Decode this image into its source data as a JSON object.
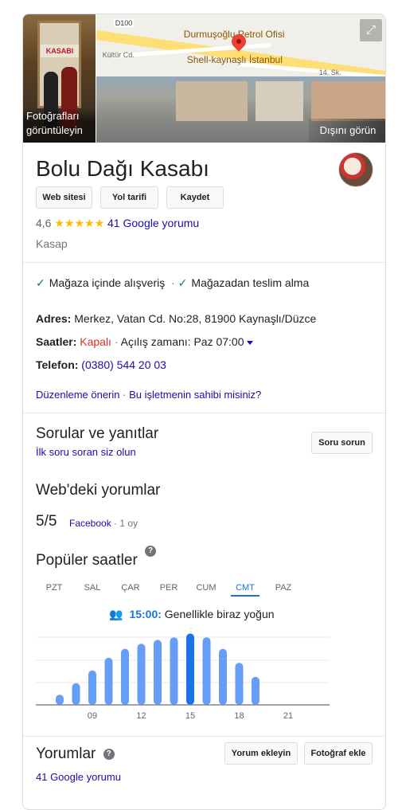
{
  "hero": {
    "photo_caption": "Fotoğrafları görüntüleyin",
    "shop_sign": "KASABI",
    "outside_caption": "Dışını görün",
    "map_labels": {
      "road": "D100",
      "poi1": "Durmuşoğlu Petrol Ofisi",
      "poi2": "Shell-kaynaşlı İstanbul",
      "street1": "Kültür Cd.",
      "street2": "14. Sk."
    }
  },
  "business": {
    "name": "Bolu Dağı Kasabı",
    "buttons": [
      "Web sitesi",
      "Yol tarifi",
      "Kaydet"
    ],
    "rating": "4,6",
    "stars_value": 4.6,
    "reviews_link": "41 Google yorumu",
    "category": "Kasap"
  },
  "features": [
    "Mağaza içinde alışveriş",
    "Mağazadan teslim alma"
  ],
  "info": {
    "address_label": "Adres:",
    "address": "Merkez, Vatan Cd. No:28, 81900 Kaynaşlı/Düzce",
    "hours_label": "Saatler:",
    "hours_status": "Kapalı",
    "hours_sep": "·",
    "hours_next": "Açılış zamanı: Paz 07:00",
    "phone_label": "Telefon:",
    "phone": "(0380) 544 20 03"
  },
  "suggest": {
    "edit": "Düzenleme önerin",
    "sep": "·",
    "owner": "Bu işletmenin sahibi misiniz?"
  },
  "qa": {
    "title": "Sorular ve yanıtlar",
    "first": "İlk soru soran siz olun",
    "ask_button": "Soru sorun"
  },
  "web_reviews": {
    "title": "Web'deki yorumlar",
    "score": "5/5",
    "source": "Facebook",
    "sep": "·",
    "count": "1 oy"
  },
  "popular": {
    "title": "Popüler saatler",
    "days": [
      "PZT",
      "SAL",
      "ÇAR",
      "PER",
      "CUM",
      "CMT",
      "PAZ"
    ],
    "selected_day": "CMT",
    "live_time": "15:00:",
    "live_text": "Genellikle biraz yoğun",
    "ticks": [
      "09",
      "12",
      "15",
      "18",
      "21"
    ],
    "accent": "#1a73e8",
    "bar_color": "#669df6"
  },
  "chart_data": {
    "type": "bar",
    "categories": [
      "07",
      "08",
      "09",
      "10",
      "11",
      "12",
      "13",
      "14",
      "15",
      "16",
      "17",
      "18",
      "19"
    ],
    "values": [
      8,
      17,
      27,
      37,
      44,
      48,
      51,
      53,
      56,
      53,
      44,
      33,
      22
    ],
    "highlight": "15",
    "ylim": [
      0,
      100
    ]
  },
  "reviews": {
    "title": "Yorumlar",
    "link": "41 Google yorumu",
    "add_button": "Yorum ekleyin",
    "photo_button": "Fotoğraf ekle"
  }
}
